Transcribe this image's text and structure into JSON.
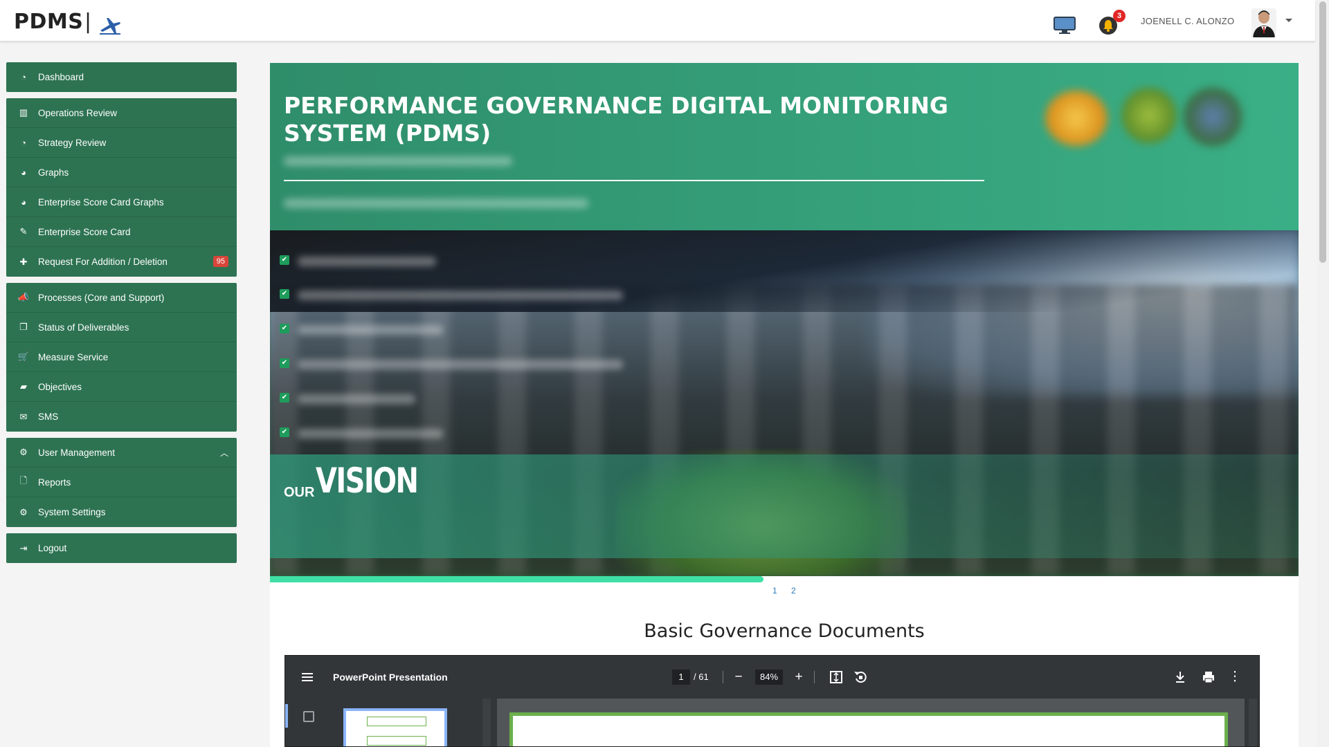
{
  "header": {
    "brand": "PDMS",
    "separator": "|",
    "user_name": "JOENELL C. ALONZO",
    "notification_count": "3",
    "icons": [
      "desktop-monitor-icon",
      "bell-icon",
      "user-avatar",
      "caret-down-icon"
    ]
  },
  "sidebar": {
    "groups": [
      {
        "items": [
          {
            "label": "Dashboard",
            "icon": "dashboard-icon"
          }
        ]
      },
      {
        "items": [
          {
            "label": "Operations Review",
            "icon": "bar-chart-icon"
          },
          {
            "label": "Strategy Review",
            "icon": "dashboard-icon"
          },
          {
            "label": "Graphs",
            "icon": "pie-chart-icon"
          },
          {
            "label": "Enterprise Score Card Graphs",
            "icon": "pie-chart-icon"
          },
          {
            "label": "Enterprise Score Card",
            "icon": "edit-icon"
          },
          {
            "label": "Request For Addition / Deletion",
            "icon": "plus-icon",
            "badge": "95"
          }
        ]
      },
      {
        "items": [
          {
            "label": "Processes (Core and Support)",
            "icon": "bullhorn-icon"
          },
          {
            "label": "Status of Deliverables",
            "icon": "files-icon"
          },
          {
            "label": "Measure Service",
            "icon": "cart-icon"
          },
          {
            "label": "Objectives",
            "icon": "book-icon"
          },
          {
            "label": "SMS",
            "icon": "envelope-icon"
          }
        ]
      },
      {
        "items": [
          {
            "label": "User Management",
            "icon": "gear-icon",
            "expanded": true
          },
          {
            "label": "Reports",
            "icon": "file-icon"
          },
          {
            "label": "System Settings",
            "icon": "gear-icon"
          }
        ]
      },
      {
        "items": [
          {
            "label": "Logout",
            "icon": "sign-out-icon"
          }
        ]
      }
    ]
  },
  "banner": {
    "title": "PERFORMANCE GOVERNANCE DIGITAL MONITORING SYSTEM (PDMS)",
    "vision_prefix": "OUR",
    "vision_word": "VISION",
    "slide_progress": 0.48,
    "pages": [
      "1",
      "2"
    ]
  },
  "documents": {
    "section_title": "Basic Governance Documents",
    "viewer": {
      "title": "PowerPoint Presentation",
      "current_page": "1",
      "total_pages": "/ 61",
      "zoom": "84%"
    }
  },
  "colors": {
    "sidebar_bg": "#2d7352",
    "banner_green": "#35a07a",
    "progress": "#3fe0a6",
    "badge_red": "#d9453a"
  }
}
